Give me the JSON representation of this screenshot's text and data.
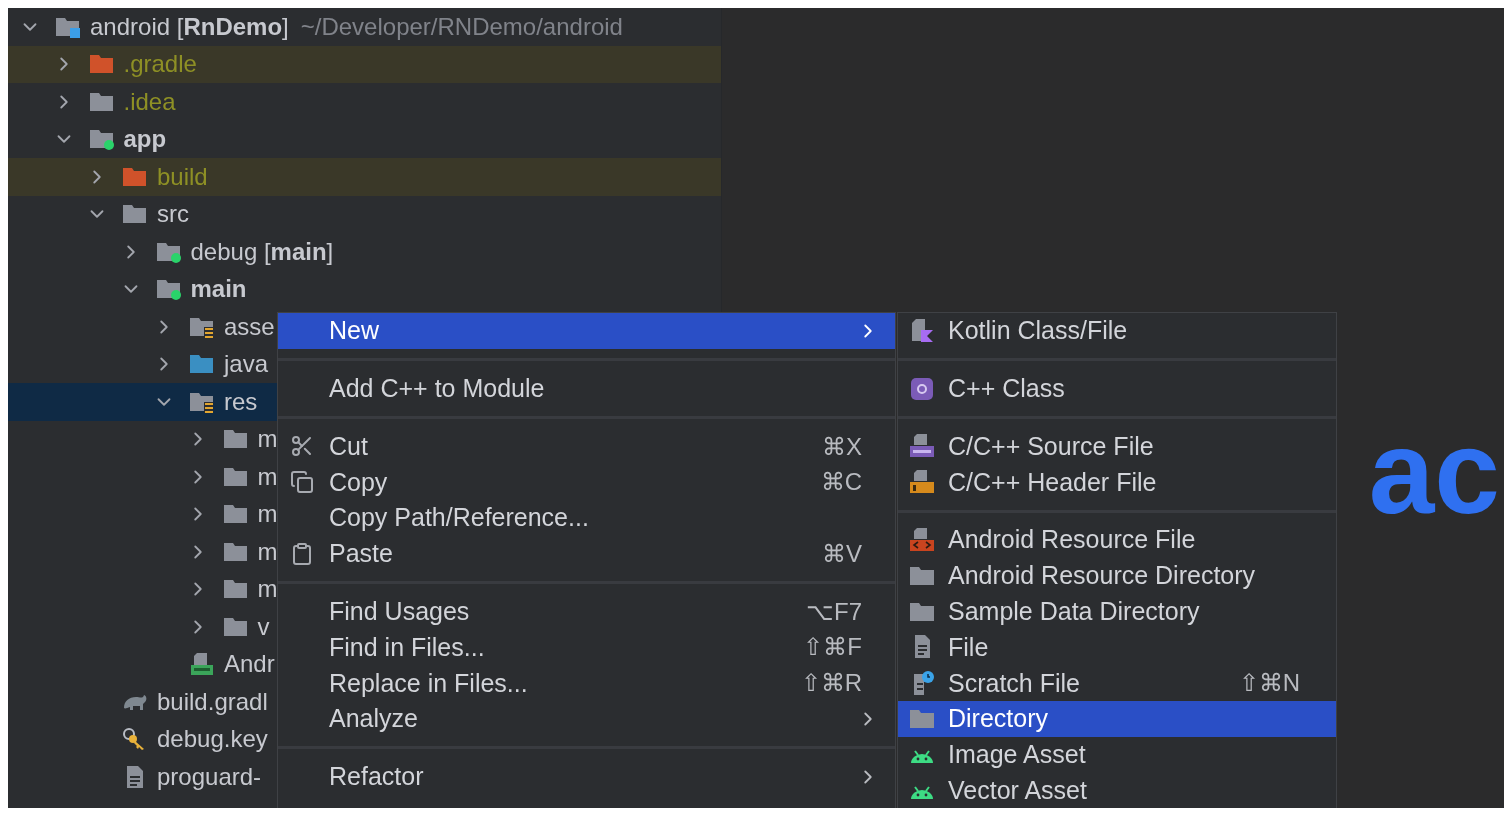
{
  "tree": [
    {
      "label": "android [**RnDemo**]",
      "path": "~/Developer/RNDemo/android",
      "kind": "module-root",
      "expanded": true,
      "selected": false,
      "highlighted": false,
      "ignored": false,
      "bold": false,
      "children": [
        {
          "label": ".gradle",
          "kind": "excluded",
          "expanded": false,
          "selected": false,
          "highlighted": true,
          "ignored": true,
          "bold": false
        },
        {
          "label": ".idea",
          "kind": "folder",
          "expanded": false,
          "selected": false,
          "highlighted": false,
          "ignored": true,
          "bold": false
        },
        {
          "label": "app",
          "kind": "module",
          "expanded": true,
          "selected": false,
          "highlighted": false,
          "ignored": false,
          "bold": true,
          "children": [
            {
              "label": "build",
              "kind": "excluded",
              "expanded": false,
              "selected": false,
              "highlighted": true,
              "ignored": true,
              "bold": false
            },
            {
              "label": "src",
              "kind": "folder",
              "expanded": true,
              "selected": false,
              "highlighted": false,
              "ignored": false,
              "bold": false,
              "children": [
                {
                  "label": "debug [**main**]",
                  "kind": "module",
                  "expanded": false,
                  "selected": false,
                  "highlighted": false,
                  "ignored": false,
                  "bold": false
                },
                {
                  "label": "main",
                  "kind": "module",
                  "expanded": true,
                  "selected": false,
                  "highlighted": false,
                  "ignored": false,
                  "bold": true,
                  "children": [
                    {
                      "label": "asse",
                      "kind": "resources",
                      "expanded": false,
                      "selected": false,
                      "highlighted": false,
                      "ignored": false,
                      "bold": false
                    },
                    {
                      "label": "java",
                      "kind": "source",
                      "expanded": false,
                      "selected": false,
                      "highlighted": false,
                      "ignored": false,
                      "bold": false
                    },
                    {
                      "label": "res",
                      "kind": "resources",
                      "expanded": true,
                      "selected": true,
                      "highlighted": false,
                      "ignored": false,
                      "bold": false,
                      "children": [
                        {
                          "label": "m",
                          "kind": "folder",
                          "expanded": false,
                          "selected": false,
                          "highlighted": false,
                          "ignored": false,
                          "bold": false
                        },
                        {
                          "label": "m",
                          "kind": "folder",
                          "expanded": false,
                          "selected": false,
                          "highlighted": false,
                          "ignored": false,
                          "bold": false
                        },
                        {
                          "label": "m",
                          "kind": "folder",
                          "expanded": false,
                          "selected": false,
                          "highlighted": false,
                          "ignored": false,
                          "bold": false
                        },
                        {
                          "label": "m",
                          "kind": "folder",
                          "expanded": false,
                          "selected": false,
                          "highlighted": false,
                          "ignored": false,
                          "bold": false
                        },
                        {
                          "label": "m",
                          "kind": "folder",
                          "expanded": false,
                          "selected": false,
                          "highlighted": false,
                          "ignored": false,
                          "bold": false
                        },
                        {
                          "label": "v",
                          "kind": "folder",
                          "expanded": false,
                          "selected": false,
                          "highlighted": false,
                          "ignored": false,
                          "bold": false
                        }
                      ]
                    },
                    {
                      "label": "Andr",
                      "kind": "manifest",
                      "selected": false,
                      "highlighted": false,
                      "ignored": false,
                      "bold": false
                    }
                  ]
                }
              ]
            },
            {
              "label": "build.gradl",
              "kind": "gradle",
              "selected": false,
              "highlighted": false,
              "ignored": false,
              "bold": false
            },
            {
              "label": "debug.key",
              "kind": "key",
              "selected": false,
              "highlighted": false,
              "ignored": false,
              "bold": false
            },
            {
              "label": "proguard-",
              "kind": "text",
              "selected": false,
              "highlighted": false,
              "ignored": false,
              "bold": false
            }
          ]
        }
      ]
    }
  ],
  "context_menu": {
    "groups": [
      [
        {
          "label": "New",
          "selected": true,
          "submenu": true
        }
      ],
      [
        {
          "label": "Add C++ to Module",
          "selected": false,
          "submenu": false
        }
      ],
      [
        {
          "label": "Cut",
          "kind": "cut",
          "shortcut": "⌘X",
          "selected": false,
          "submenu": false
        },
        {
          "label": "Copy",
          "kind": "copy",
          "shortcut": "⌘C",
          "selected": false,
          "submenu": false
        },
        {
          "label": "Copy Path/Reference...",
          "selected": false,
          "submenu": false
        },
        {
          "label": "Paste",
          "kind": "paste",
          "shortcut": "⌘V",
          "selected": false,
          "submenu": false
        }
      ],
      [
        {
          "label": "Find Usages",
          "shortcut": "⌥F7",
          "selected": false,
          "submenu": false
        },
        {
          "label": "Find in Files...",
          "shortcut": "⇧⌘F",
          "selected": false,
          "submenu": false
        },
        {
          "label": "Replace in Files...",
          "shortcut": "⇧⌘R",
          "selected": false,
          "submenu": false
        },
        {
          "label": "Analyze",
          "selected": false,
          "submenu": true
        }
      ],
      [
        {
          "label": "Refactor",
          "selected": false,
          "submenu": true
        }
      ]
    ]
  },
  "new_submenu": {
    "groups": [
      [
        {
          "label": "Kotlin Class/File",
          "kind": "kotlin",
          "selected": false
        }
      ],
      [
        {
          "label": "C++ Class",
          "kind": "class",
          "selected": false
        }
      ],
      [
        {
          "label": "C/C++ Source File",
          "kind": "source",
          "selected": false
        },
        {
          "label": "C/C++ Header File",
          "kind": "header",
          "selected": false
        }
      ],
      [
        {
          "label": "Android Resource File",
          "kind": "resource",
          "selected": false
        },
        {
          "label": "Android Resource Directory",
          "kind": "folder",
          "selected": false
        },
        {
          "label": "Sample Data Directory",
          "kind": "folder",
          "selected": false
        },
        {
          "label": "File",
          "kind": "file",
          "selected": false
        },
        {
          "label": "Scratch File",
          "kind": "scratch",
          "shortcut": "⇧⌘N",
          "selected": false
        },
        {
          "label": "Directory",
          "kind": "folder",
          "selected": true
        },
        {
          "label": "Image Asset",
          "kind": "android",
          "selected": false
        },
        {
          "label": "Vector Asset",
          "kind": "android",
          "selected": false
        }
      ]
    ]
  },
  "editor": {
    "large_text": "ac"
  }
}
